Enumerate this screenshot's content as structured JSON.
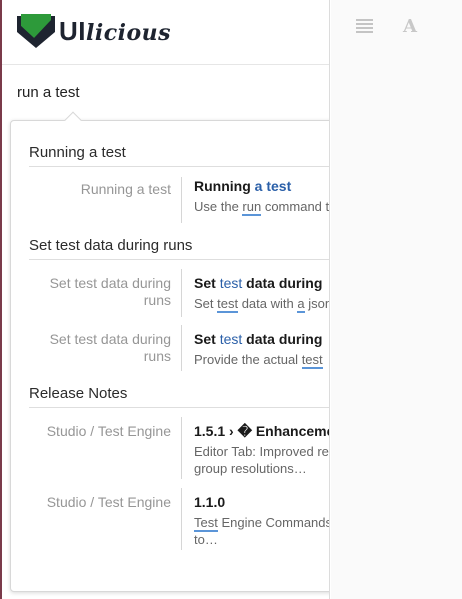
{
  "app": {
    "logo_text_main": "UI",
    "logo_text_script": "licious"
  },
  "search": {
    "value": "run a test"
  },
  "toolbar": {
    "menu_icon": "list-icon",
    "font_icon": "font-size-icon",
    "font_glyph": "A"
  },
  "results": {
    "sections": [
      {
        "title": "Running a test",
        "hits": [
          {
            "category": "Running a test",
            "title_parts": [
              "Running ",
              "a test"
            ],
            "text_parts": [
              "Use the ",
              "run",
              " command t"
            ]
          }
        ]
      },
      {
        "title": "Set test data during runs",
        "hits": [
          {
            "category": "Set test data during runs",
            "title_parts": [
              "Set ",
              "test",
              " data during"
            ],
            "text_parts": [
              "Set ",
              "test",
              " data with ",
              "a",
              " json"
            ]
          },
          {
            "category": "Set test data during runs",
            "title_parts": [
              "Set ",
              "test",
              " data during"
            ],
            "text_parts": [
              "Provide the actual ",
              "test"
            ]
          }
        ]
      },
      {
        "title": "Release Notes",
        "hits": [
          {
            "category": "Studio / Test Engine",
            "title": "1.5.1 › � Enhanceme",
            "text_line1": "Editor Tab: Improved re",
            "text_line2": "group resolutions…"
          },
          {
            "category": "Studio / Test Engine",
            "title": "1.1.0",
            "text_parts": [
              "Test",
              " Engine Commands"
            ],
            "text_line2": "to…"
          }
        ]
      }
    ]
  },
  "colors": {
    "highlight": "#2a5fa8",
    "underline": "#5b95d8",
    "logo_green": "#2d9a3a"
  }
}
